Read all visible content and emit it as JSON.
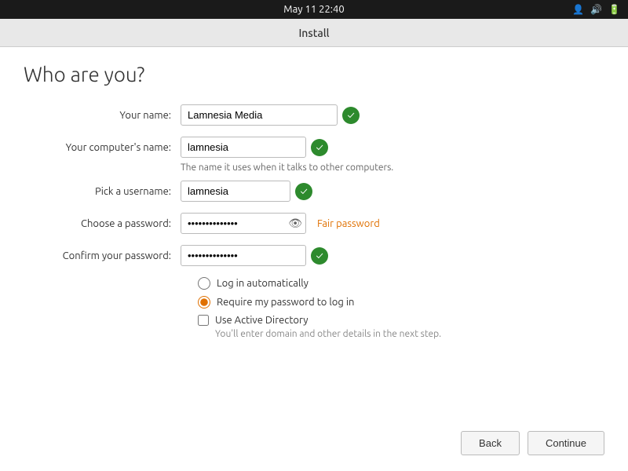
{
  "topbar": {
    "datetime": "May 11  22:40"
  },
  "titlebar": {
    "title": "Install"
  },
  "page": {
    "heading": "Who are you?"
  },
  "form": {
    "your_name_label": "Your name:",
    "your_name_value": "Lamnesia Media",
    "computer_name_label": "Your computer's name:",
    "computer_name_value": "lamnesia",
    "computer_name_hint": "The name it uses when it talks to other computers.",
    "username_label": "Pick a username:",
    "username_value": "lamnesia",
    "password_label": "Choose a password:",
    "password_value": "••••••••••••",
    "password_strength": "Fair password",
    "confirm_label": "Confirm your password:",
    "confirm_value": "••••••••••••"
  },
  "options": {
    "log_in_auto_label": "Log in automatically",
    "require_password_label": "Require my password to log in",
    "use_ad_label": "Use Active Directory",
    "ad_hint": "You'll enter domain and other details in the next step."
  },
  "buttons": {
    "back": "Back",
    "continue": "Continue"
  },
  "icons": {
    "check": "✓",
    "eye": "👁",
    "person": "🔑",
    "sound": "🔊",
    "battery": "🔋"
  }
}
